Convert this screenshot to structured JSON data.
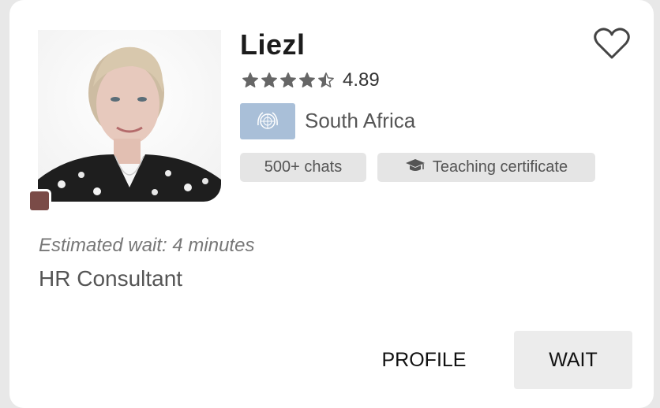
{
  "tutor": {
    "name": "Liezl",
    "rating": "4.89",
    "rating_stars": 4.5,
    "country": "South Africa",
    "badges": [
      "500+ chats",
      "Teaching certificate"
    ],
    "estimated_wait": "Estimated wait: 4 minutes",
    "title": "HR Consultant"
  },
  "actions": {
    "profile_label": "PROFILE",
    "wait_label": "WAIT"
  },
  "icons": {
    "favorite": "heart-outline-icon",
    "certificate": "graduation-cap-icon",
    "flag": "un-flag-icon",
    "status": "status-dot"
  },
  "colors": {
    "status_dot": "#7a4b47",
    "star": "#666666",
    "flag_bg": "#a9bfd8",
    "badge_bg": "#e5e5e5",
    "wait_button_bg": "#ececec"
  }
}
